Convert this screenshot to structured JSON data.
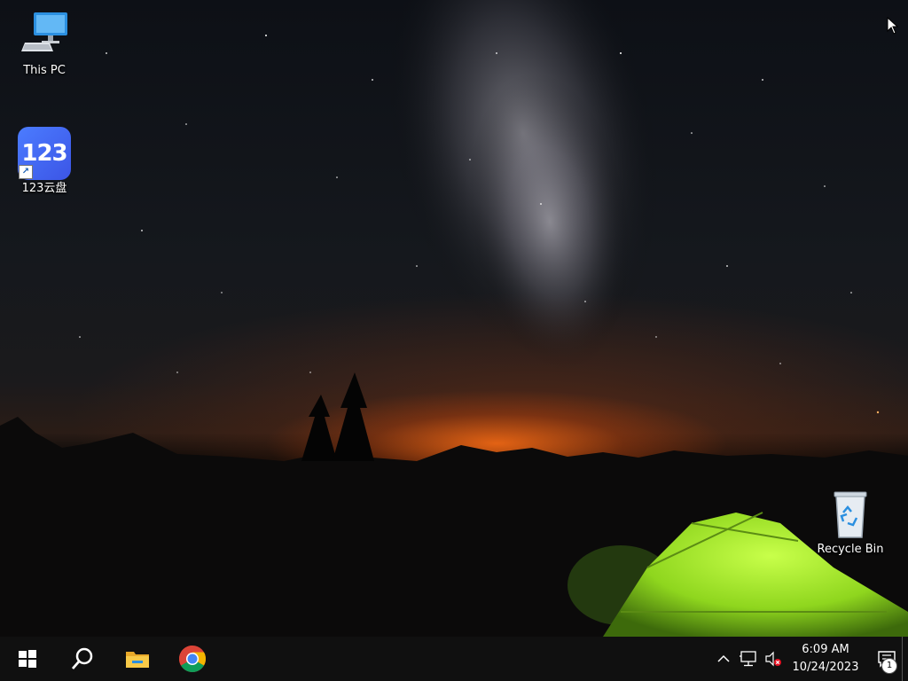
{
  "desktop": {
    "icons": [
      {
        "label": "This PC",
        "icon": "this-pc-icon"
      },
      {
        "label": "123云盘",
        "icon": "app-123-icon",
        "glyph": "123"
      },
      {
        "label": "Recycle Bin",
        "icon": "recycle-bin-icon"
      }
    ]
  },
  "taskbar": {
    "start_icon": "windows-start-icon",
    "search_icon": "search-icon",
    "pinned": [
      "file-explorer-icon",
      "chrome-icon"
    ],
    "tray": {
      "chevron_icon": "chevron-up-icon",
      "network_icon": "network-icon",
      "volume_icon": "volume-muted-icon",
      "time": "6:09 AM",
      "date": "10/24/2023",
      "notification_count": "1"
    }
  },
  "colors": {
    "taskbar": "#101010",
    "tent_green": "#8fd61e",
    "horizon_orange": "#ff6a14",
    "icon_123_blue": "#4b6dff"
  }
}
